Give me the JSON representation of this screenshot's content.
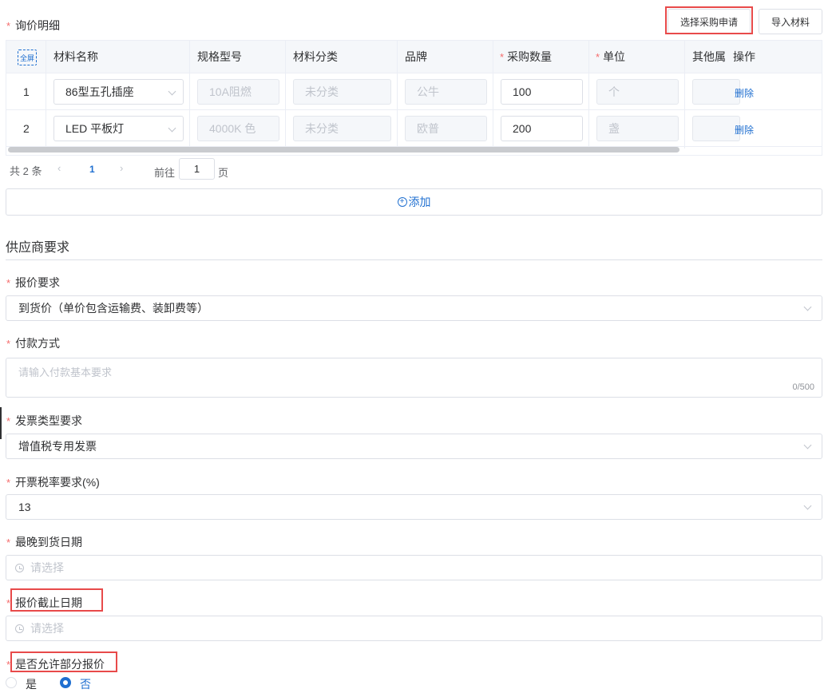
{
  "header": {
    "title": "询价明细",
    "select_request_label": "选择采购申请",
    "import_label": "导入材料"
  },
  "table": {
    "fullscreen_label": "全屏",
    "columns": [
      "材料名称",
      "规格型号",
      "材料分类",
      "品牌",
      "采购数量",
      "单位",
      "其他属",
      "操作"
    ],
    "rows": [
      {
        "index": "1",
        "name": "86型五孔插座",
        "spec": "10A阻燃",
        "category": "未分类",
        "brand": "公牛",
        "qty": "100",
        "unit": "个",
        "action": "删除"
      },
      {
        "index": "2",
        "name": "LED 平板灯",
        "spec": "4000K 色",
        "category": "未分类",
        "brand": "欧普",
        "qty": "200",
        "unit": "盏",
        "action": "删除"
      }
    ]
  },
  "pagination": {
    "total": "共 2 条",
    "current": "1",
    "goto_label": "前往",
    "goto_value": "1",
    "page_suffix": "页"
  },
  "add_label": "添加",
  "supplier": {
    "section_title": "供应商要求",
    "quote_req_label": "报价要求",
    "quote_req_value": "到货价（单价包含运输费、装卸费等）",
    "payment_label": "付款方式",
    "payment_placeholder": "请输入付款基本要求",
    "payment_counter": "0/500",
    "invoice_label": "发票类型要求",
    "invoice_value": "增值税专用发票",
    "tax_label": "开票税率要求(%)",
    "tax_value": "13",
    "latest_date_label": "最晚到货日期",
    "latest_date_placeholder": "请选择",
    "deadline_label": "报价截止日期",
    "deadline_placeholder": "请选择",
    "partial_label": "是否允许部分报价",
    "partial_options": [
      "是",
      "否"
    ],
    "partial_selected": "否"
  },
  "colors": {
    "accent": "#1f6fd0",
    "required": "#f56c6c",
    "highlight": "#e84a4a"
  }
}
